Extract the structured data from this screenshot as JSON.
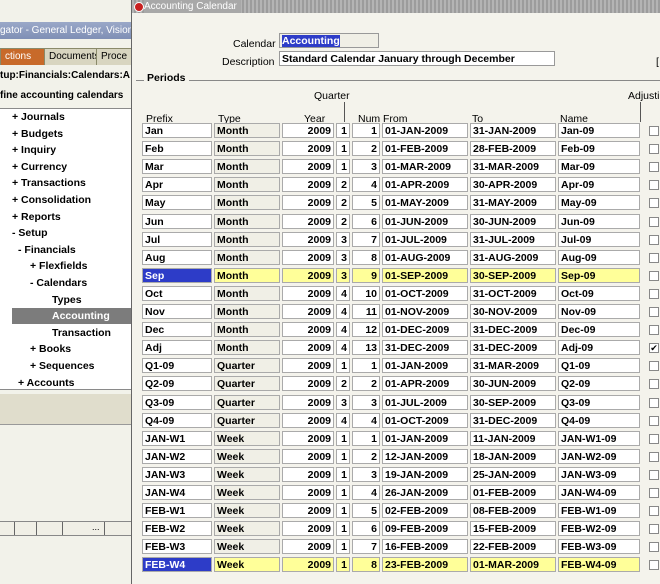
{
  "navigator": {
    "title": "gator - General Ledger, Vision C",
    "tabs": [
      {
        "label": "ctions",
        "active": true
      },
      {
        "label": "Documents",
        "active": false
      },
      {
        "label": "Proce",
        "active": false
      }
    ],
    "path": "tup:Financials:Calendars:A",
    "function": "fine accounting calendars",
    "tree": [
      {
        "label": "+ Journals",
        "indent": 0
      },
      {
        "label": "+ Budgets",
        "indent": 0
      },
      {
        "label": "+ Inquiry",
        "indent": 0
      },
      {
        "label": "+ Currency",
        "indent": 0
      },
      {
        "label": "+ Transactions",
        "indent": 0
      },
      {
        "label": "+ Consolidation",
        "indent": 0
      },
      {
        "label": "+ Reports",
        "indent": 0
      },
      {
        "label": "- Setup",
        "indent": 0
      },
      {
        "label": "- Financials",
        "indent": 1
      },
      {
        "label": "+ Flexfields",
        "indent": 2
      },
      {
        "label": "- Calendars",
        "indent": 2
      },
      {
        "label": "Types",
        "indent": 3
      },
      {
        "label": "Accounting",
        "indent": 3,
        "selected": true
      },
      {
        "label": "Transaction",
        "indent": 3
      },
      {
        "label": "+ Books",
        "indent": 2
      },
      {
        "label": "+ Sequences",
        "indent": 2
      },
      {
        "label": "+ Accounts",
        "indent": 1
      }
    ],
    "status_ellipsis": "..."
  },
  "window": {
    "title": "Accounting Calendar",
    "calendar_label": "Calendar",
    "calendar_value": "Accounting",
    "description_label": "Description",
    "description_value": "Standard Calendar January through December",
    "bracket": "[",
    "periods_label": "Periods",
    "headers": {
      "quarter": "Quarter",
      "prefix": "Prefix",
      "type": "Type",
      "year": "Year",
      "num": "Num",
      "from": "From",
      "to": "To",
      "name": "Name",
      "adjusting": "Adjusti"
    },
    "rows": [
      {
        "prefix": "Jan",
        "type": "Month",
        "year": "2009",
        "quarter": "1",
        "num": "1",
        "from": "01-JAN-2009",
        "to": "31-JAN-2009",
        "name": "Jan-09",
        "adj": false
      },
      {
        "prefix": "Feb",
        "type": "Month",
        "year": "2009",
        "quarter": "1",
        "num": "2",
        "from": "01-FEB-2009",
        "to": "28-FEB-2009",
        "name": "Feb-09",
        "adj": false
      },
      {
        "prefix": "Mar",
        "type": "Month",
        "year": "2009",
        "quarter": "1",
        "num": "3",
        "from": "01-MAR-2009",
        "to": "31-MAR-2009",
        "name": "Mar-09",
        "adj": false
      },
      {
        "prefix": "Apr",
        "type": "Month",
        "year": "2009",
        "quarter": "2",
        "num": "4",
        "from": "01-APR-2009",
        "to": "30-APR-2009",
        "name": "Apr-09",
        "adj": false
      },
      {
        "prefix": "May",
        "type": "Month",
        "year": "2009",
        "quarter": "2",
        "num": "5",
        "from": "01-MAY-2009",
        "to": "31-MAY-2009",
        "name": "May-09",
        "adj": false
      },
      {
        "prefix": "Jun",
        "type": "Month",
        "year": "2009",
        "quarter": "2",
        "num": "6",
        "from": "01-JUN-2009",
        "to": "30-JUN-2009",
        "name": "Jun-09",
        "adj": false
      },
      {
        "prefix": "Jul",
        "type": "Month",
        "year": "2009",
        "quarter": "3",
        "num": "7",
        "from": "01-JUL-2009",
        "to": "31-JUL-2009",
        "name": "Jul-09",
        "adj": false
      },
      {
        "prefix": "Aug",
        "type": "Month",
        "year": "2009",
        "quarter": "3",
        "num": "8",
        "from": "01-AUG-2009",
        "to": "31-AUG-2009",
        "name": "Aug-09",
        "adj": false
      },
      {
        "prefix": "Sep",
        "type": "Month",
        "year": "2009",
        "quarter": "3",
        "num": "9",
        "from": "01-SEP-2009",
        "to": "30-SEP-2009",
        "name": "Sep-09",
        "adj": false,
        "current": true,
        "prefix_highlight": true
      },
      {
        "prefix": "Oct",
        "type": "Month",
        "year": "2009",
        "quarter": "4",
        "num": "10",
        "from": "01-OCT-2009",
        "to": "31-OCT-2009",
        "name": "Oct-09",
        "adj": false
      },
      {
        "prefix": "Nov",
        "type": "Month",
        "year": "2009",
        "quarter": "4",
        "num": "11",
        "from": "01-NOV-2009",
        "to": "30-NOV-2009",
        "name": "Nov-09",
        "adj": false
      },
      {
        "prefix": "Dec",
        "type": "Month",
        "year": "2009",
        "quarter": "4",
        "num": "12",
        "from": "01-DEC-2009",
        "to": "31-DEC-2009",
        "name": "Dec-09",
        "adj": false
      },
      {
        "prefix": "Adj",
        "type": "Month",
        "year": "2009",
        "quarter": "4",
        "num": "13",
        "from": "31-DEC-2009",
        "to": "31-DEC-2009",
        "name": "Adj-09",
        "adj": true
      },
      {
        "prefix": "Q1-09",
        "type": "Quarter",
        "year": "2009",
        "quarter": "1",
        "num": "1",
        "from": "01-JAN-2009",
        "to": "31-MAR-2009",
        "name": "Q1-09",
        "adj": false
      },
      {
        "prefix": "Q2-09",
        "type": "Quarter",
        "year": "2009",
        "quarter": "2",
        "num": "2",
        "from": "01-APR-2009",
        "to": "30-JUN-2009",
        "name": "Q2-09",
        "adj": false
      },
      {
        "prefix": "Q3-09",
        "type": "Quarter",
        "year": "2009",
        "quarter": "3",
        "num": "3",
        "from": "01-JUL-2009",
        "to": "30-SEP-2009",
        "name": "Q3-09",
        "adj": false
      },
      {
        "prefix": "Q4-09",
        "type": "Quarter",
        "year": "2009",
        "quarter": "4",
        "num": "4",
        "from": "01-OCT-2009",
        "to": "31-DEC-2009",
        "name": "Q4-09",
        "adj": false
      },
      {
        "prefix": "JAN-W1",
        "type": "Week",
        "year": "2009",
        "quarter": "1",
        "num": "1",
        "from": "01-JAN-2009",
        "to": "11-JAN-2009",
        "name": "JAN-W1-09",
        "adj": false
      },
      {
        "prefix": "JAN-W2",
        "type": "Week",
        "year": "2009",
        "quarter": "1",
        "num": "2",
        "from": "12-JAN-2009",
        "to": "18-JAN-2009",
        "name": "JAN-W2-09",
        "adj": false
      },
      {
        "prefix": "JAN-W3",
        "type": "Week",
        "year": "2009",
        "quarter": "1",
        "num": "3",
        "from": "19-JAN-2009",
        "to": "25-JAN-2009",
        "name": "JAN-W3-09",
        "adj": false
      },
      {
        "prefix": "JAN-W4",
        "type": "Week",
        "year": "2009",
        "quarter": "1",
        "num": "4",
        "from": "26-JAN-2009",
        "to": "01-FEB-2009",
        "name": "JAN-W4-09",
        "adj": false
      },
      {
        "prefix": "FEB-W1",
        "type": "Week",
        "year": "2009",
        "quarter": "1",
        "num": "5",
        "from": "02-FEB-2009",
        "to": "08-FEB-2009",
        "name": "FEB-W1-09",
        "adj": false
      },
      {
        "prefix": "FEB-W2",
        "type": "Week",
        "year": "2009",
        "quarter": "1",
        "num": "6",
        "from": "09-FEB-2009",
        "to": "15-FEB-2009",
        "name": "FEB-W2-09",
        "adj": false
      },
      {
        "prefix": "FEB-W3",
        "type": "Week",
        "year": "2009",
        "quarter": "1",
        "num": "7",
        "from": "16-FEB-2009",
        "to": "22-FEB-2009",
        "name": "FEB-W3-09",
        "adj": false
      },
      {
        "prefix": "FEB-W4",
        "type": "Week",
        "year": "2009",
        "quarter": "1",
        "num": "8",
        "from": "23-FEB-2009",
        "to": "01-MAR-2009",
        "name": "FEB-W4-09",
        "adj": false,
        "current": true,
        "prefix_highlight": true
      }
    ]
  }
}
